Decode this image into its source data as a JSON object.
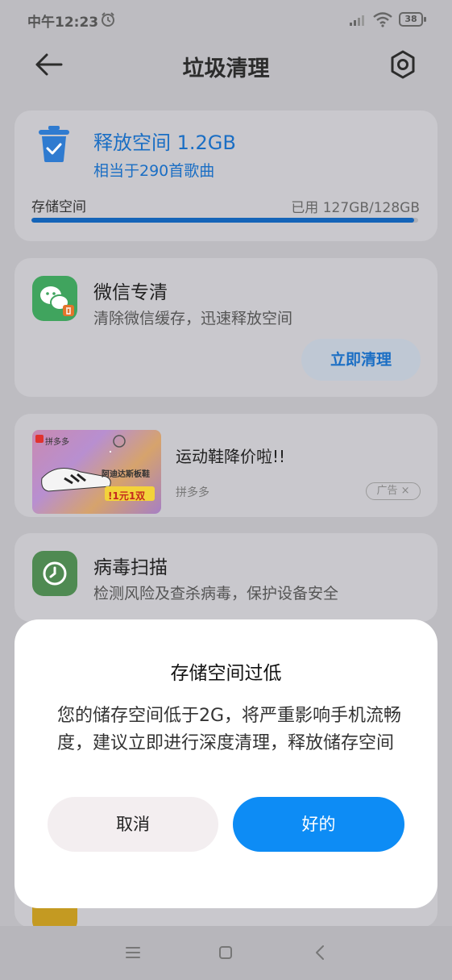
{
  "status_bar": {
    "time": "中午12:23",
    "battery": "38",
    "icons": [
      "alarm-icon",
      "signal-icon",
      "wifi-icon",
      "battery-icon"
    ]
  },
  "header": {
    "title": "垃圾清理",
    "back_icon": "arrow-left-icon",
    "settings_icon": "settings-icon"
  },
  "storage_card": {
    "release": "释放空间 1.2GB",
    "equivalent": "相当于290首歌曲",
    "label": "存储空间",
    "used": "已用 127GB/128GB",
    "used_fraction": 0.99
  },
  "wechat_card": {
    "title": "微信专清",
    "description": "清除微信缓存，迅速释放空间",
    "button": "立即清理"
  },
  "ad_card": {
    "title": "运动鞋降价啦!!",
    "source": "拼多多",
    "badge": "广告 ×",
    "image_texts": [
      "拼多多",
      "阿迪达斯板鞋",
      "!1元1双"
    ]
  },
  "virus_card": {
    "title": "病毒扫描",
    "description": "检测风险及查杀病毒，保护设备安全"
  },
  "dialog": {
    "title": "存储空间过低",
    "body": "您的储存空间低于2G，将严重影响手机流畅度，建议立即进行深度清理，释放储存空间",
    "cancel": "取消",
    "ok": "好的"
  },
  "colors": {
    "accent": "#0d8cf5",
    "link": "#1a6ec4",
    "scrim": "#bdbcc1"
  }
}
